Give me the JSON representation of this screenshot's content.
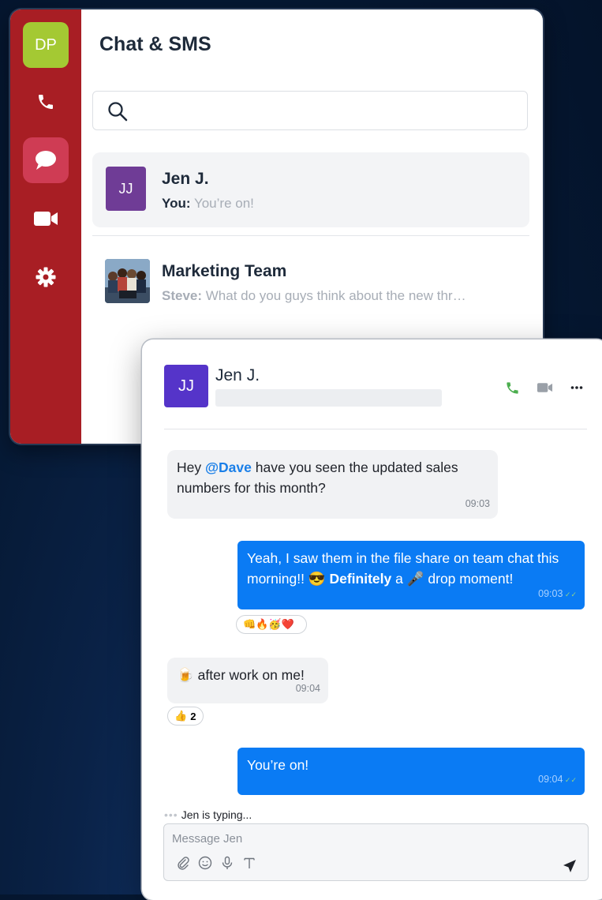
{
  "app": {
    "title": "Chat & SMS"
  },
  "rail": {
    "user_initials": "DP",
    "icons": [
      "phone-icon",
      "chat-icon",
      "video-icon",
      "gear-icon"
    ],
    "accent": "#a81e24"
  },
  "search": {
    "placeholder": ""
  },
  "conversations": [
    {
      "name": "Jen J.",
      "initials": "JJ",
      "preview_sender": "You:",
      "preview_text": "You’re on!",
      "selected": true
    },
    {
      "name": "Marketing Team",
      "preview_sender": "Steve:",
      "preview_text": "What do you guys think about the new thr…",
      "selected": false
    }
  ],
  "chat": {
    "contact_name": "Jen J.",
    "contact_initials": "JJ",
    "messages": [
      {
        "direction": "in",
        "before": "Hey ",
        "mention": "@Dave",
        "after": " have you seen the updated sales numbers for this month?",
        "time": "09:03"
      },
      {
        "direction": "out",
        "part1": "Yeah, I saw them in the file share on team chat this morning!! ",
        "emoji1": "😎",
        "bold": "Definitely",
        "part2": " a ",
        "emoji2": "🎤",
        "part3": " drop moment!",
        "time": "09:03",
        "reactions": "👊🔥🥳❤️"
      },
      {
        "direction": "in",
        "emoji": "🍺",
        "text": " after work on me!",
        "time": "09:04",
        "reaction_emoji": "👍",
        "reaction_count": "2"
      },
      {
        "direction": "out",
        "text": "You’re on!",
        "time": "09:04"
      }
    ],
    "typing_indicator": "Jen is typing...",
    "composer_placeholder": "Message Jen"
  }
}
